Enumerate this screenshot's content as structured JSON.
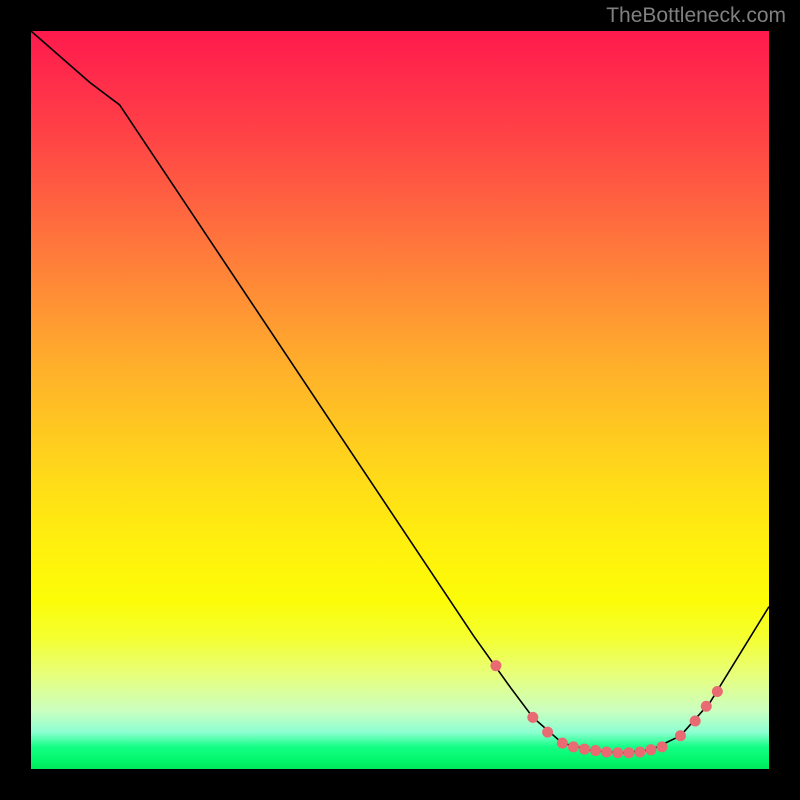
{
  "watermark": "TheBottleneck.com",
  "chart_data": {
    "type": "line",
    "title": "",
    "xlabel": "",
    "ylabel": "",
    "x_range": [
      0,
      100
    ],
    "y_range": [
      0,
      100
    ],
    "series": [
      {
        "name": "bottleneck-curve",
        "x": [
          0,
          8,
          12,
          20,
          30,
          40,
          50,
          60,
          65,
          68,
          72,
          76,
          80,
          84,
          88,
          92,
          100
        ],
        "y": [
          100,
          93,
          90,
          78,
          63,
          48,
          33,
          18,
          11,
          7,
          3.5,
          2.5,
          2.2,
          2.6,
          4.5,
          9,
          22
        ]
      }
    ],
    "markers": {
      "name": "highlight-dots",
      "x": [
        63,
        68,
        70,
        72,
        73.5,
        75,
        76.5,
        78,
        79.5,
        81,
        82.5,
        84,
        85.5,
        88,
        90,
        91.5,
        93
      ],
      "y": [
        14,
        7,
        5,
        3.5,
        3.0,
        2.7,
        2.5,
        2.3,
        2.2,
        2.2,
        2.3,
        2.6,
        3.0,
        4.5,
        6.5,
        8.5,
        10.5
      ],
      "color": "#e86a72",
      "radius": 5.5
    },
    "line_color": "#000000",
    "line_width": 1.6
  }
}
